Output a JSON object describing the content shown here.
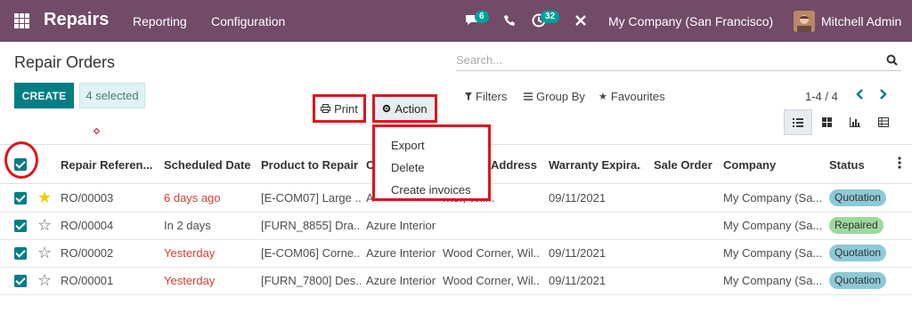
{
  "navbar": {
    "app_name": "Repairs",
    "menu": [
      "Reporting",
      "Configuration"
    ],
    "messages_badge": "6",
    "activities_badge": "32",
    "company": "My Company (San Francisco)",
    "user": "Mitchell Admin",
    "bg_color": "#714b67"
  },
  "control": {
    "title": "Repair Orders",
    "search_placeholder": "Search...",
    "create_label": "CREATE",
    "selected_label": "4 selected",
    "print_label": "Print",
    "action_label": "Action",
    "filters_label": "Filters",
    "groupby_label": "Group By",
    "favourites_label": "Favourites",
    "pager": "1-4 / 4",
    "accent_color": "#017e84"
  },
  "action_menu": [
    "Export",
    "Delete",
    "Create invoices"
  ],
  "table": {
    "columns": [
      "Repair Referen...",
      "Scheduled Date",
      "Product to Repair",
      "C",
      "Address",
      "Warranty Expira...",
      "Sale Order",
      "Company",
      "Status"
    ],
    "rows": [
      {
        "ref": "RO/00003",
        "date": "6 days ago",
        "date_late": true,
        "product": "[E-COM07] Large ...",
        "customer": "A",
        "address": "rner, Wil...",
        "warranty": "09/11/2021",
        "sale_order": "",
        "company": "My Company (Sa...",
        "status": "Quotation",
        "starred": true
      },
      {
        "ref": "RO/00004",
        "date": "In 2 days",
        "date_late": false,
        "product": "[FURN_8855] Dra...",
        "customer": "Azure Interior",
        "address": "",
        "warranty": "",
        "sale_order": "",
        "company": "My Company (Sa...",
        "status": "Repaired",
        "starred": false
      },
      {
        "ref": "RO/00002",
        "date": "Yesterday",
        "date_late": true,
        "product": "[E-COM06] Corne...",
        "customer": "Azure Interior",
        "address": "Wood Corner, Wil...",
        "warranty": "09/11/2021",
        "sale_order": "",
        "company": "My Company (Sa...",
        "status": "Quotation",
        "starred": false
      },
      {
        "ref": "RO/00001",
        "date": "Yesterday",
        "date_late": true,
        "product": "[FURN_7800] Des...",
        "customer": "Azure Interior",
        "address": "Wood Corner, Wil...",
        "warranty": "09/11/2021",
        "sale_order": "",
        "company": "My Company (Sa...",
        "status": "Quotation",
        "starred": false
      }
    ]
  }
}
